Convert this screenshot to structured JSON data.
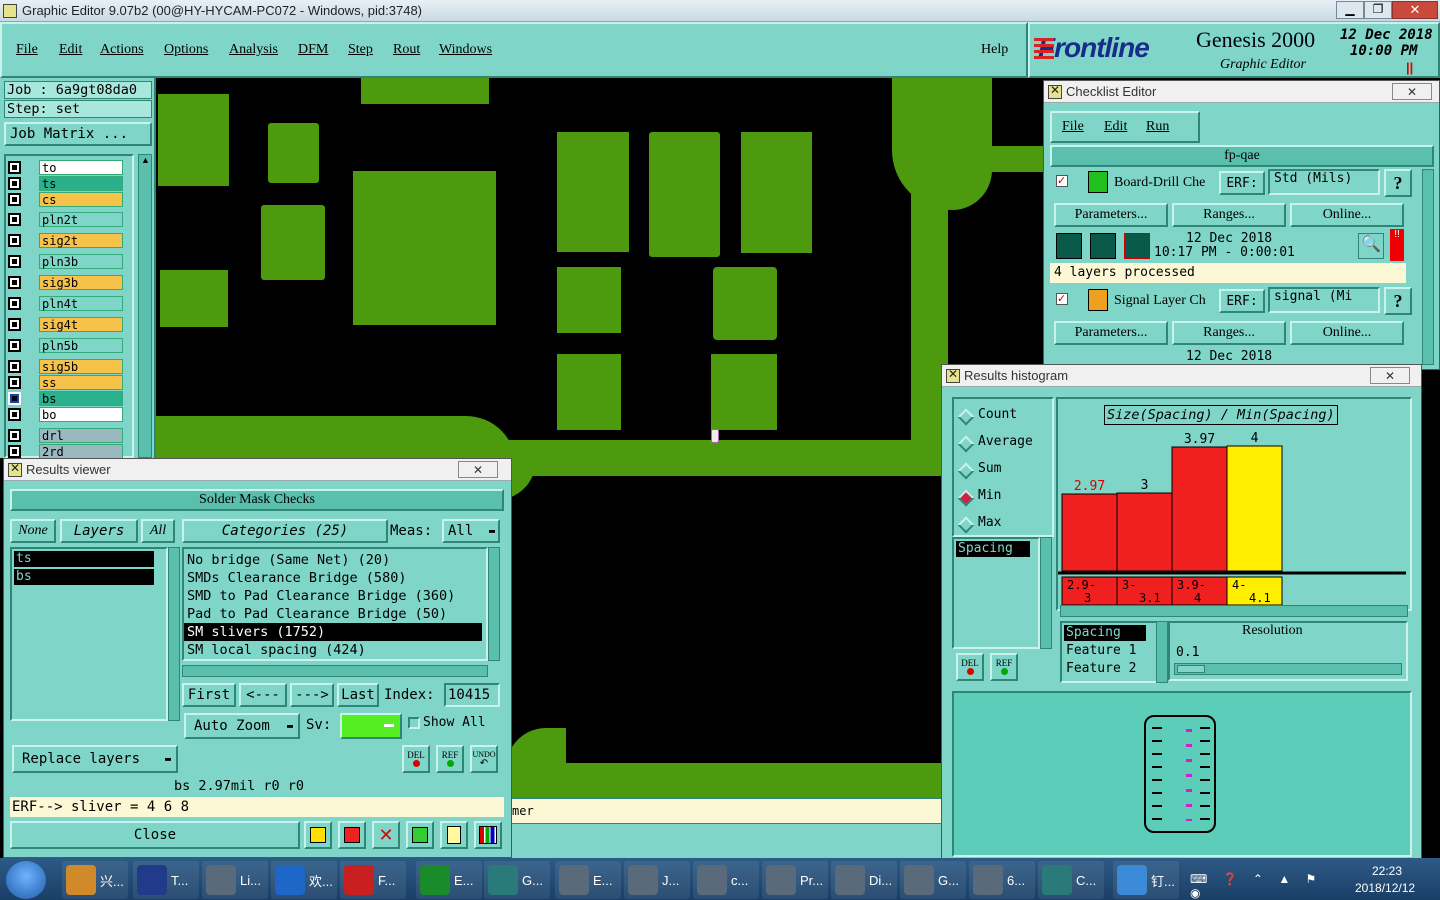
{
  "app": {
    "title": "Graphic Editor 9.07b2 (00@HY-HYCAM-PC072 - Windows, pid:3748)"
  },
  "menu": {
    "file": "File",
    "edit": "Edit",
    "actions": "Actions",
    "options": "Options",
    "analysis": "Analysis",
    "dfm": "DFM",
    "step": "Step",
    "rout": "Rout",
    "windows": "Windows",
    "help": "Help"
  },
  "brand": {
    "logo": "Frontline",
    "product": "Genesis 2000",
    "subtitle": "Graphic Editor",
    "date": "12 Dec 2018",
    "time": "10:00 PM",
    "pause": "||"
  },
  "job": {
    "job": "Job : 6a9gt08da0",
    "step": "Step: set",
    "matrix": "Job Matrix ..."
  },
  "layers": [
    {
      "name": "to",
      "color": "#ffffff"
    },
    {
      "name": "ts",
      "color": "#2ab08a"
    },
    {
      "name": "cs",
      "color": "#f6c24a"
    },
    {
      "name": "pln2t",
      "color": "#7fd6c8"
    },
    {
      "name": "sig2t",
      "color": "#f6c24a"
    },
    {
      "name": "pln3b",
      "color": "#7fd6c8"
    },
    {
      "name": "sig3b",
      "color": "#f6c24a"
    },
    {
      "name": "pln4t",
      "color": "#7fd6c8"
    },
    {
      "name": "sig4t",
      "color": "#f6c24a"
    },
    {
      "name": "pln5b",
      "color": "#7fd6c8"
    },
    {
      "name": "sig5b",
      "color": "#f6c24a"
    },
    {
      "name": "ss",
      "color": "#f6c24a"
    },
    {
      "name": "bs",
      "color": "#2ab08a"
    },
    {
      "name": "bo",
      "color": "#ffffff"
    },
    {
      "name": "drl",
      "color": "#9ab8c0"
    },
    {
      "name": "2rd",
      "color": "#9ab8c0"
    }
  ],
  "results": {
    "window_title": "Results viewer",
    "header": "Solder Mask Checks",
    "none": "None",
    "layers": "Layers",
    "all": "All",
    "layer_items": [
      "ts",
      "bs"
    ],
    "categories": "Categories (25)",
    "meas_label": "Meas:",
    "meas_value": "All",
    "cat_items": [
      "No bridge (Same Net) (20)",
      "SMDs Clearance Bridge (580)",
      "SMD to Pad Clearance Bridge (360)",
      "Pad to Pad Clearance Bridge (50)",
      "SM slivers (1752)",
      "SM local spacing (424)"
    ],
    "first": "First",
    "prev": "<---",
    "next": "--->",
    "last": "Last",
    "index_label": "Index:",
    "index_value": "10415",
    "autozoom": "Auto Zoom",
    "sv": "Sv:",
    "showall": "Show All",
    "replace": "Replace layers",
    "del": "DEL",
    "ref": "REF",
    "undo": "UNDO",
    "status": "bs 2.97mil  r0  r0",
    "erf": "ERF--> sliver = 4 6 8",
    "close": "Close"
  },
  "editor_msg": "mer",
  "checklist": {
    "window_title": "Checklist Editor",
    "file": "File",
    "edit": "Edit",
    "run": "Run",
    "name": "fp-qae",
    "item1": {
      "name": "Board-Drill Che",
      "erf": "ERF:",
      "erf_val": "Std (Mils)",
      "params": "Parameters...",
      "ranges": "Ranges...",
      "online": "Online...",
      "date": "12 Dec 2018",
      "time": "10:17 PM - 0:00:01",
      "status": "4 layers processed",
      "q": "?"
    },
    "item2": {
      "name": "Signal Layer Ch",
      "erf": "ERF:",
      "erf_val": "signal (Mi",
      "params": "Parameters...",
      "ranges": "Ranges...",
      "online": "Online...",
      "date": "12 Dec 2018",
      "q": "?"
    }
  },
  "histogram": {
    "window_title": "Results histogram",
    "options": [
      {
        "label": "Count",
        "selected": false
      },
      {
        "label": "Average",
        "selected": false
      },
      {
        "label": "Sum",
        "selected": false
      },
      {
        "label": "Min",
        "selected": true
      },
      {
        "label": "Max",
        "selected": false
      }
    ],
    "list_item": "Spacing",
    "del": "DEL",
    "ref": "REF",
    "title": "Size(Spacing) / Min(Spacing)",
    "bars": [
      {
        "value": "2.97",
        "color": "#f02020",
        "label": "2.9-\n3"
      },
      {
        "value": "3",
        "color": "#f02020",
        "label": "3-\n3.1"
      },
      {
        "value": "3.97",
        "color": "#f02020",
        "label": "3.9-\n4"
      },
      {
        "value": "4",
        "color": "#ffee00",
        "label": "4-\n4.1"
      }
    ],
    "fields": [
      "Spacing",
      "Feature 1",
      "Feature 2"
    ],
    "resolution_label": "Resolution",
    "resolution_value": "0.1"
  },
  "taskbar": {
    "items": [
      "兴...",
      "T...",
      "Li...",
      "欢...",
      "F...",
      "E...",
      "G...",
      "E...",
      "J...",
      "c...",
      "Pr...",
      "Di...",
      "G...",
      "6...",
      "C...",
      "钉..."
    ],
    "time": "22:23",
    "date": "2018/12/12"
  }
}
